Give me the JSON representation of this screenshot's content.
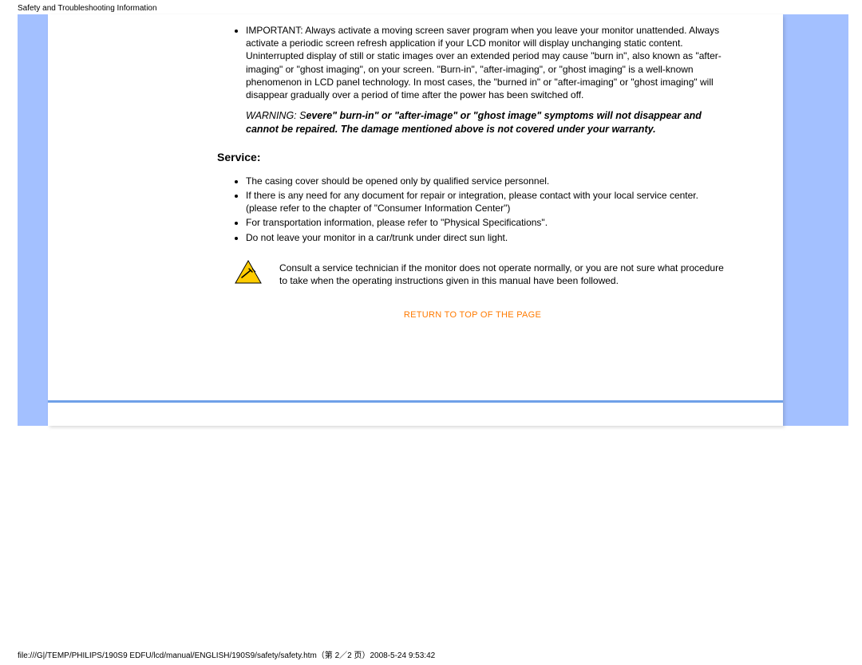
{
  "header": {
    "title": "Safety and Troubleshooting Information"
  },
  "bullets_top": [
    "IMPORTANT: Always activate a moving screen saver program when you leave your monitor unattended. Always activate a periodic screen refresh application if your LCD monitor will display unchanging static content. Uninterrupted display of still or static images over an extended period may cause \"burn in\", also known as \"after-imaging\" or \"ghost imaging\", on your screen. \"Burn-in\", \"after-imaging\", or \"ghost imaging\" is a well-known phenomenon in LCD panel technology. In most cases, the \"burned in\" or \"after-imaging\" or \"ghost imaging\" will disappear gradually over a period of time after the power has been switched off."
  ],
  "warning": {
    "prefix": "WARNING: S",
    "part1": "evere\" burn-in\" or \"after-image\" or \"ghost image\" symptoms will ",
    "not": "not",
    "part2": " disappear and ",
    "cannot": "cannot",
    "part3": " be repaired. The damage mentioned above is not covered under your warranty."
  },
  "service": {
    "heading": "Service:",
    "bullets": [
      "The casing cover should be opened only by qualified service personnel.",
      "If there is any need for any document for repair or integration, please contact with your local service center. (please refer to the chapter of \"Consumer Information Center\")",
      "For transportation information, please refer to \"Physical Specifications\".",
      "Do not leave your monitor in a car/trunk under direct sun light."
    ],
    "tech_note": "Consult a service technician if the monitor does not operate normally, or you are not sure what procedure to take when the operating instructions given in this manual have been followed."
  },
  "return_link": "RETURN TO TOP OF THE PAGE",
  "footer": "file:///G|/TEMP/PHILIPS/190S9 EDFU/lcd/manual/ENGLISH/190S9/safety/safety.htm（第 2／2 页）2008-5-24 9:53:42"
}
